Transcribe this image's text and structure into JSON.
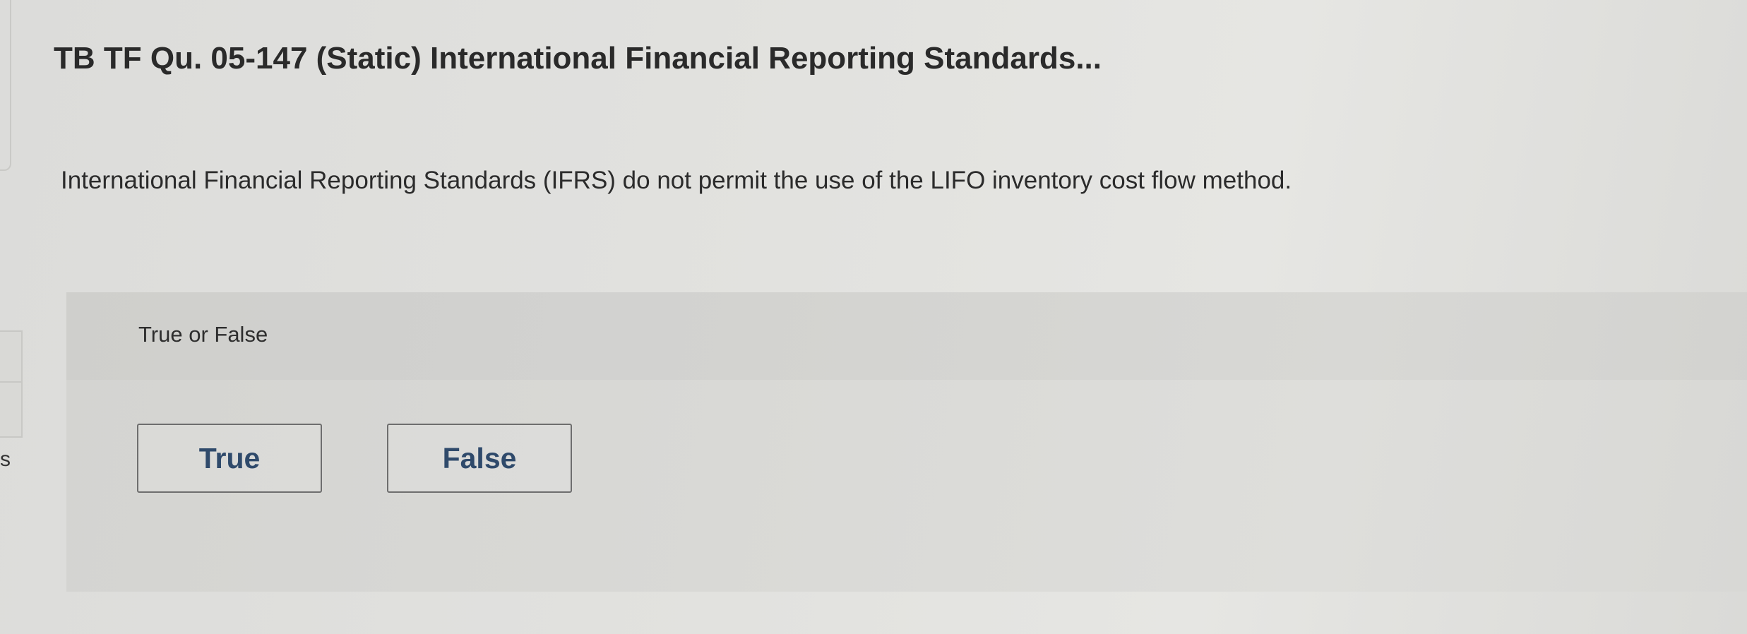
{
  "question": {
    "title": "TB TF Qu. 05-147 (Static) International Financial Reporting Standards...",
    "prompt": "International Financial Reporting Standards (IFRS) do not permit the use of the LIFO inventory cost flow method."
  },
  "answer_panel": {
    "type_label": "True or False",
    "choices": [
      {
        "label": "True"
      },
      {
        "label": "False"
      }
    ]
  },
  "sidebar": {
    "cutoff_text": "s"
  },
  "colors": {
    "background": "#e0e0dd",
    "panel": "#d9d9d6",
    "button_text": "#2f4a6b",
    "button_border": "#6e6e6e"
  }
}
